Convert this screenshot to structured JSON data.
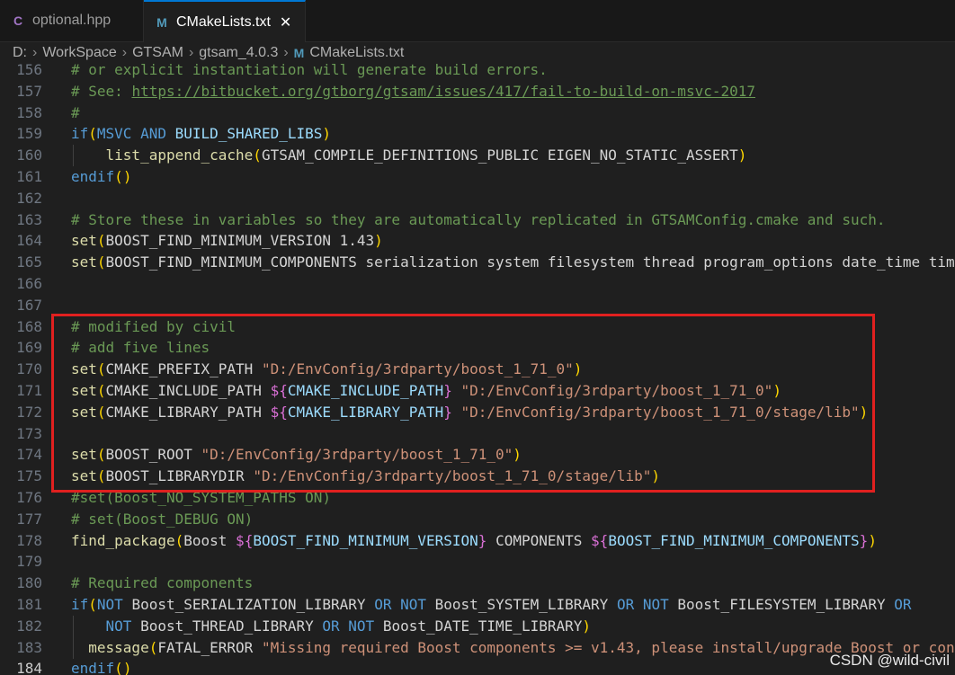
{
  "tabs": [
    {
      "label": "optional.hpp",
      "icon": "C"
    },
    {
      "label": "CMakeLists.txt",
      "icon": "M",
      "close": "✕"
    }
  ],
  "breadcrumb": {
    "items": [
      "D:",
      "WorkSpace",
      "GTSAM",
      "gtsam_4.0.3",
      "CMakeLists.txt"
    ],
    "file_icon": "M"
  },
  "lines": [
    {
      "n": "156",
      "code": "# or explicit instantiation will generate build errors."
    },
    {
      "n": "157",
      "code": "# See: https://bitbucket.org/gtborg/gtsam/issues/417/fail-to-build-on-msvc-2017"
    },
    {
      "n": "158",
      "code": "#"
    },
    {
      "n": "159",
      "code": "if(MSVC AND BUILD_SHARED_LIBS)"
    },
    {
      "n": "160",
      "code": "    list_append_cache(GTSAM_COMPILE_DEFINITIONS_PUBLIC EIGEN_NO_STATIC_ASSERT)"
    },
    {
      "n": "161",
      "code": "endif()"
    },
    {
      "n": "162",
      "code": ""
    },
    {
      "n": "163",
      "code": "# Store these in variables so they are automatically replicated in GTSAMConfig.cmake and such."
    },
    {
      "n": "164",
      "code": "set(BOOST_FIND_MINIMUM_VERSION 1.43)"
    },
    {
      "n": "165",
      "code": "set(BOOST_FIND_MINIMUM_COMPONENTS serialization system filesystem thread program_options date_time tim"
    },
    {
      "n": "166",
      "code": ""
    },
    {
      "n": "167",
      "code": ""
    },
    {
      "n": "168",
      "code": "# modified by civil"
    },
    {
      "n": "169",
      "code": "# add five lines"
    },
    {
      "n": "170",
      "code": "set(CMAKE_PREFIX_PATH \"D:/EnvConfig/3rdparty/boost_1_71_0\")"
    },
    {
      "n": "171",
      "code": "set(CMAKE_INCLUDE_PATH ${CMAKE_INCLUDE_PATH} \"D:/EnvConfig/3rdparty/boost_1_71_0\")"
    },
    {
      "n": "172",
      "code": "set(CMAKE_LIBRARY_PATH ${CMAKE_LIBRARY_PATH} \"D:/EnvConfig/3rdparty/boost_1_71_0/stage/lib\")"
    },
    {
      "n": "173",
      "code": ""
    },
    {
      "n": "174",
      "code": "set(BOOST_ROOT \"D:/EnvConfig/3rdparty/boost_1_71_0\")"
    },
    {
      "n": "175",
      "code": "set(BOOST_LIBRARYDIR \"D:/EnvConfig/3rdparty/boost_1_71_0/stage/lib\")"
    },
    {
      "n": "176",
      "code": "#set(Boost_NO_SYSTEM_PATHS ON)"
    },
    {
      "n": "177",
      "code": "# set(Boost_DEBUG ON)"
    },
    {
      "n": "178",
      "code": "find_package(Boost ${BOOST_FIND_MINIMUM_VERSION} COMPONENTS ${BOOST_FIND_MINIMUM_COMPONENTS})"
    },
    {
      "n": "179",
      "code": ""
    },
    {
      "n": "180",
      "code": "# Required components"
    },
    {
      "n": "181",
      "code": "if(NOT Boost_SERIALIZATION_LIBRARY OR NOT Boost_SYSTEM_LIBRARY OR NOT Boost_FILESYSTEM_LIBRARY OR"
    },
    {
      "n": "182",
      "code": "    NOT Boost_THREAD_LIBRARY OR NOT Boost_DATE_TIME_LIBRARY)"
    },
    {
      "n": "183",
      "code": "  message(FATAL_ERROR \"Missing required Boost components >= v1.43, please install/upgrade Boost or con"
    },
    {
      "n": "184",
      "code": "endif()"
    }
  ],
  "active_line": "184",
  "watermark": "CSDN @wild-civil"
}
